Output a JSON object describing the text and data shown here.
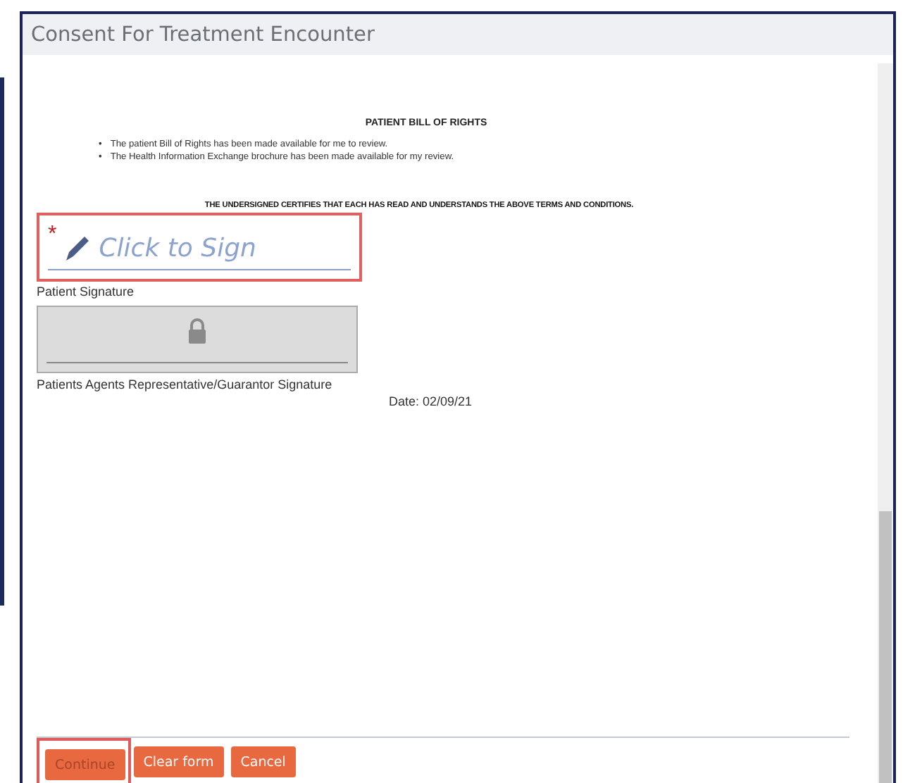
{
  "window": {
    "title": "Consent For Treatment Encounter"
  },
  "document": {
    "heading": "PATIENT BILL OF RIGHTS",
    "bullets": [
      {
        "marker": "•",
        "text": "The patient Bill of Rights has been made available for me to review."
      },
      {
        "marker": "•",
        "text": "The Health Information Exchange brochure has been made available for my review."
      }
    ],
    "certification": "THE UNDERSIGNED CERTIFIES THAT EACH HAS READ AND UNDERSTANDS THE ABOVE TERMS AND CONDITIONS."
  },
  "signatures": [
    {
      "kind": "sign",
      "placeholder": "Click to Sign",
      "required_mark": "*",
      "highlighted": true,
      "label": "Patient Signature"
    },
    {
      "kind": "locked",
      "label": "Patients Agents Representative/Guarantor Signature"
    }
  ],
  "date": "Date: 02/09/21",
  "buttons": [
    {
      "label": "Continue",
      "disabled": true,
      "highlighted": true
    },
    {
      "label": "Clear form",
      "disabled": false,
      "highlighted": false
    },
    {
      "label": "Cancel",
      "disabled": false,
      "highlighted": false
    }
  ]
}
